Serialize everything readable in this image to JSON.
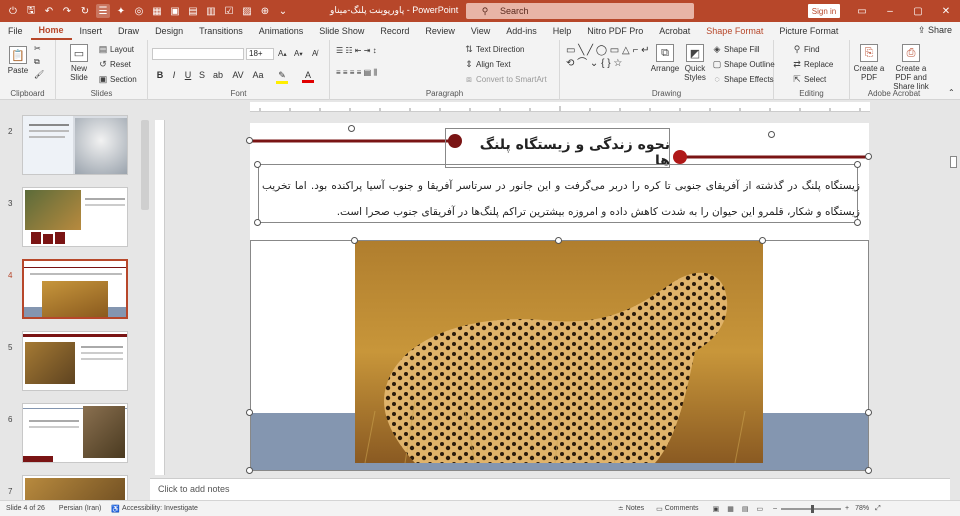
{
  "titlebar": {
    "title": "پاورپوینت پلنگ-میناو  -  PowerPoint",
    "search_placeholder": "Search",
    "signin": "Sign in",
    "qat_icons": [
      "autosave-icon",
      "undo-icon",
      "redo-icon",
      "refresh-icon",
      "slideshow-icon",
      "shapes-icon"
    ]
  },
  "tabs": [
    "File",
    "Home",
    "Insert",
    "Draw",
    "Design",
    "Transitions",
    "Animations",
    "Slide Show",
    "Record",
    "Review",
    "View",
    "Add-ins",
    "Help",
    "Nitro PDF Pro",
    "Acrobat",
    "Shape Format",
    "Picture Format"
  ],
  "share": "Share",
  "ribbon": {
    "clipboard": {
      "paste": "Paste",
      "label": "Clipboard"
    },
    "slides": {
      "new_slide": "New Slide",
      "layout": "Layout",
      "reset": "Reset",
      "section": "Section",
      "label": "Slides"
    },
    "font": {
      "font_size": "18+",
      "label": "Font"
    },
    "paragraph": {
      "text_direction": "Text Direction",
      "align_text": "Align Text",
      "smartart": "Convert to SmartArt",
      "label": "Paragraph"
    },
    "drawing": {
      "arrange": "Arrange",
      "quick_styles": "Quick Styles",
      "shape_fill": "Shape Fill",
      "shape_outline": "Shape Outline",
      "shape_effects": "Shape Effects",
      "label": "Drawing"
    },
    "editing": {
      "find": "Find",
      "replace": "Replace",
      "select": "Select",
      "label": "Editing"
    },
    "acrobat": {
      "create_pdf": "Create a PDF",
      "create_share": "Create a PDF and Share link",
      "label": "Adobe Acrobat"
    }
  },
  "thumbnails": [
    {
      "num": "2"
    },
    {
      "num": "3"
    },
    {
      "num": "4"
    },
    {
      "num": "5"
    },
    {
      "num": "6"
    },
    {
      "num": "7"
    }
  ],
  "slide": {
    "title": "نحوه زندگی و زیستگاه پلنگ ها",
    "body": "زیستگاه پلنگ در گذشته از آفریقای جنوبی تا کره را دربر می‌گرفت و این جانور در سرتاسر آفریقا و جنوب آسیا پراکنده بود. اما تخریب زیستگاه و شکار، قلمرو این حیوان را به شدت کاهش داده و امروزه بیشترین تراکم پلنگ‌ها در آفریقای جنوب صحرا است.",
    "band_color": "#8496b0",
    "accent_color": "#7a1414"
  },
  "notes": "Click to add notes",
  "status": {
    "slide_info": "Slide 4 of 26",
    "language": "Persian (Iran)",
    "accessibility": "Accessibility: Investigate",
    "notes_btn": "Notes",
    "comments_btn": "Comments",
    "zoom": "78%"
  },
  "colors": {
    "accent": "#b7472a"
  }
}
